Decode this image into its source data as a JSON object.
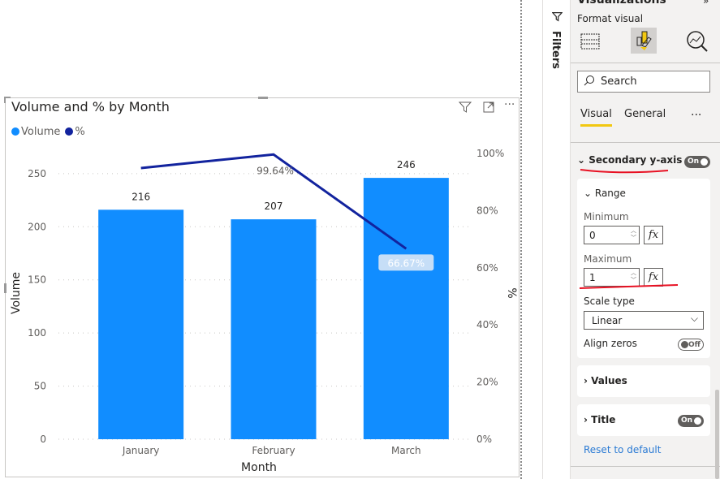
{
  "visual": {
    "title": "Volume and % by Month",
    "icons": [
      "filter-icon",
      "focus-mode-icon",
      "more-options-icon"
    ],
    "legend": [
      {
        "label": "Volume",
        "color": "#118dff"
      },
      {
        "label": "%",
        "color": "#12239e"
      }
    ]
  },
  "chart_data": {
    "type": "bar+line",
    "categories": [
      "January",
      "February",
      "March"
    ],
    "xlabel": "Month",
    "ylabel": "Volume",
    "y2label": "%",
    "ylim": [
      0,
      269
    ],
    "y2lim": [
      0,
      1
    ],
    "yticks": [
      "0",
      "50",
      "100",
      "150",
      "200",
      "250"
    ],
    "y2ticks": [
      "0%",
      "20%",
      "40%",
      "60%",
      "80%",
      "100%"
    ],
    "grid": true,
    "legend_position": "top-left",
    "series": [
      {
        "name": "Volume",
        "type": "bar",
        "axis": "primary",
        "color": "#118dff",
        "values": [
          216,
          207,
          246
        ],
        "labels": [
          "216",
          "207",
          "246"
        ]
      },
      {
        "name": "%",
        "type": "line",
        "axis": "secondary",
        "color": "#12239e",
        "values": [
          0.949,
          0.9964,
          0.6667
        ],
        "labels": [
          null,
          "99.64%",
          "66.67%"
        ]
      }
    ]
  },
  "filters": {
    "label": "Filters"
  },
  "pane": {
    "header": "Visualizations",
    "subheader": "Format visual",
    "search_placeholder": "Search",
    "tabs": [
      {
        "label": "Visual",
        "active": true
      },
      {
        "label": "General",
        "active": false
      }
    ],
    "more": "...",
    "section": {
      "label": "Secondary y-axis",
      "toggle": "On"
    },
    "range": {
      "label": "Range",
      "minimum_label": "Minimum",
      "minimum_value": "0",
      "maximum_label": "Maximum",
      "maximum_value": "1",
      "fx": "fx",
      "scale_type_label": "Scale type",
      "scale_type_value": "Linear",
      "align_zeros_label": "Align zeros",
      "align_zeros_toggle": "Off"
    },
    "values_label": "Values",
    "title_label": "Title",
    "title_toggle": "On",
    "reset": "Reset to default",
    "accent": "#f2c811",
    "annotation_color": "#e81123"
  }
}
